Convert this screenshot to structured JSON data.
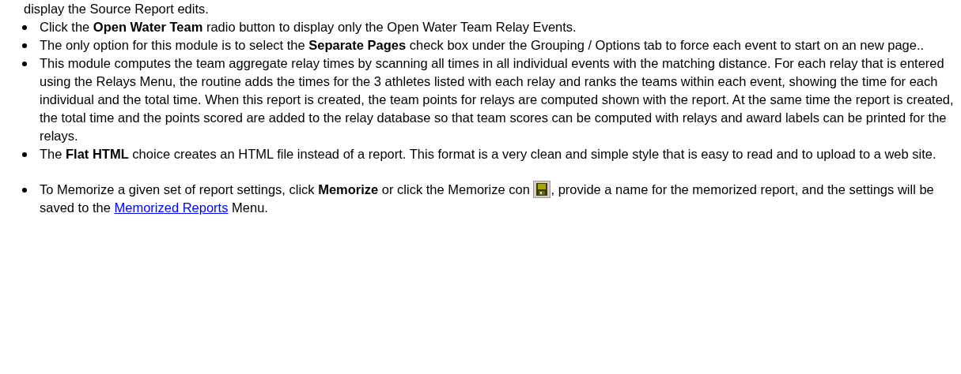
{
  "intro": "display the Source Report edits.",
  "bullets": [
    {
      "kind": "text",
      "text": "Click the **Open Water Team** radio button to display only the Open Water Team Relay Events."
    },
    {
      "kind": "text",
      "text": "The only option for this module is to select the **Separate Pages** check box under the Grouping / Options tab to force each event to start on an new page.."
    },
    {
      "kind": "text",
      "text": "This module computes the team aggregate relay times by scanning all times in all individual events with the matching distance.  For each relay that is entered using the Relays Menu, the routine adds the times for the 3 athletes listed with each relay and ranks the teams within each event, showing the time for each individual and the total time. When this report is created, the team points for relays are computed shown with the report. At the same time the report is created, the total time and the points scored are added to the relay database so that team scores can be computed with relays and award labels can be printed for the relays."
    },
    {
      "kind": "text",
      "text": "The **Flat HTML** choice creates an HTML file instead of a report. This format is a very clean and simple style that is easy to read and to upload to a web site."
    },
    {
      "kind": "icon_link",
      "before": "To Memorize a given set of report settings, click **Memorize** or click the Memorize con",
      "after": ", provide a name for the memorized report, and the settings will be saved to the",
      "link": "Memorized Reports",
      "end": "Menu."
    }
  ]
}
